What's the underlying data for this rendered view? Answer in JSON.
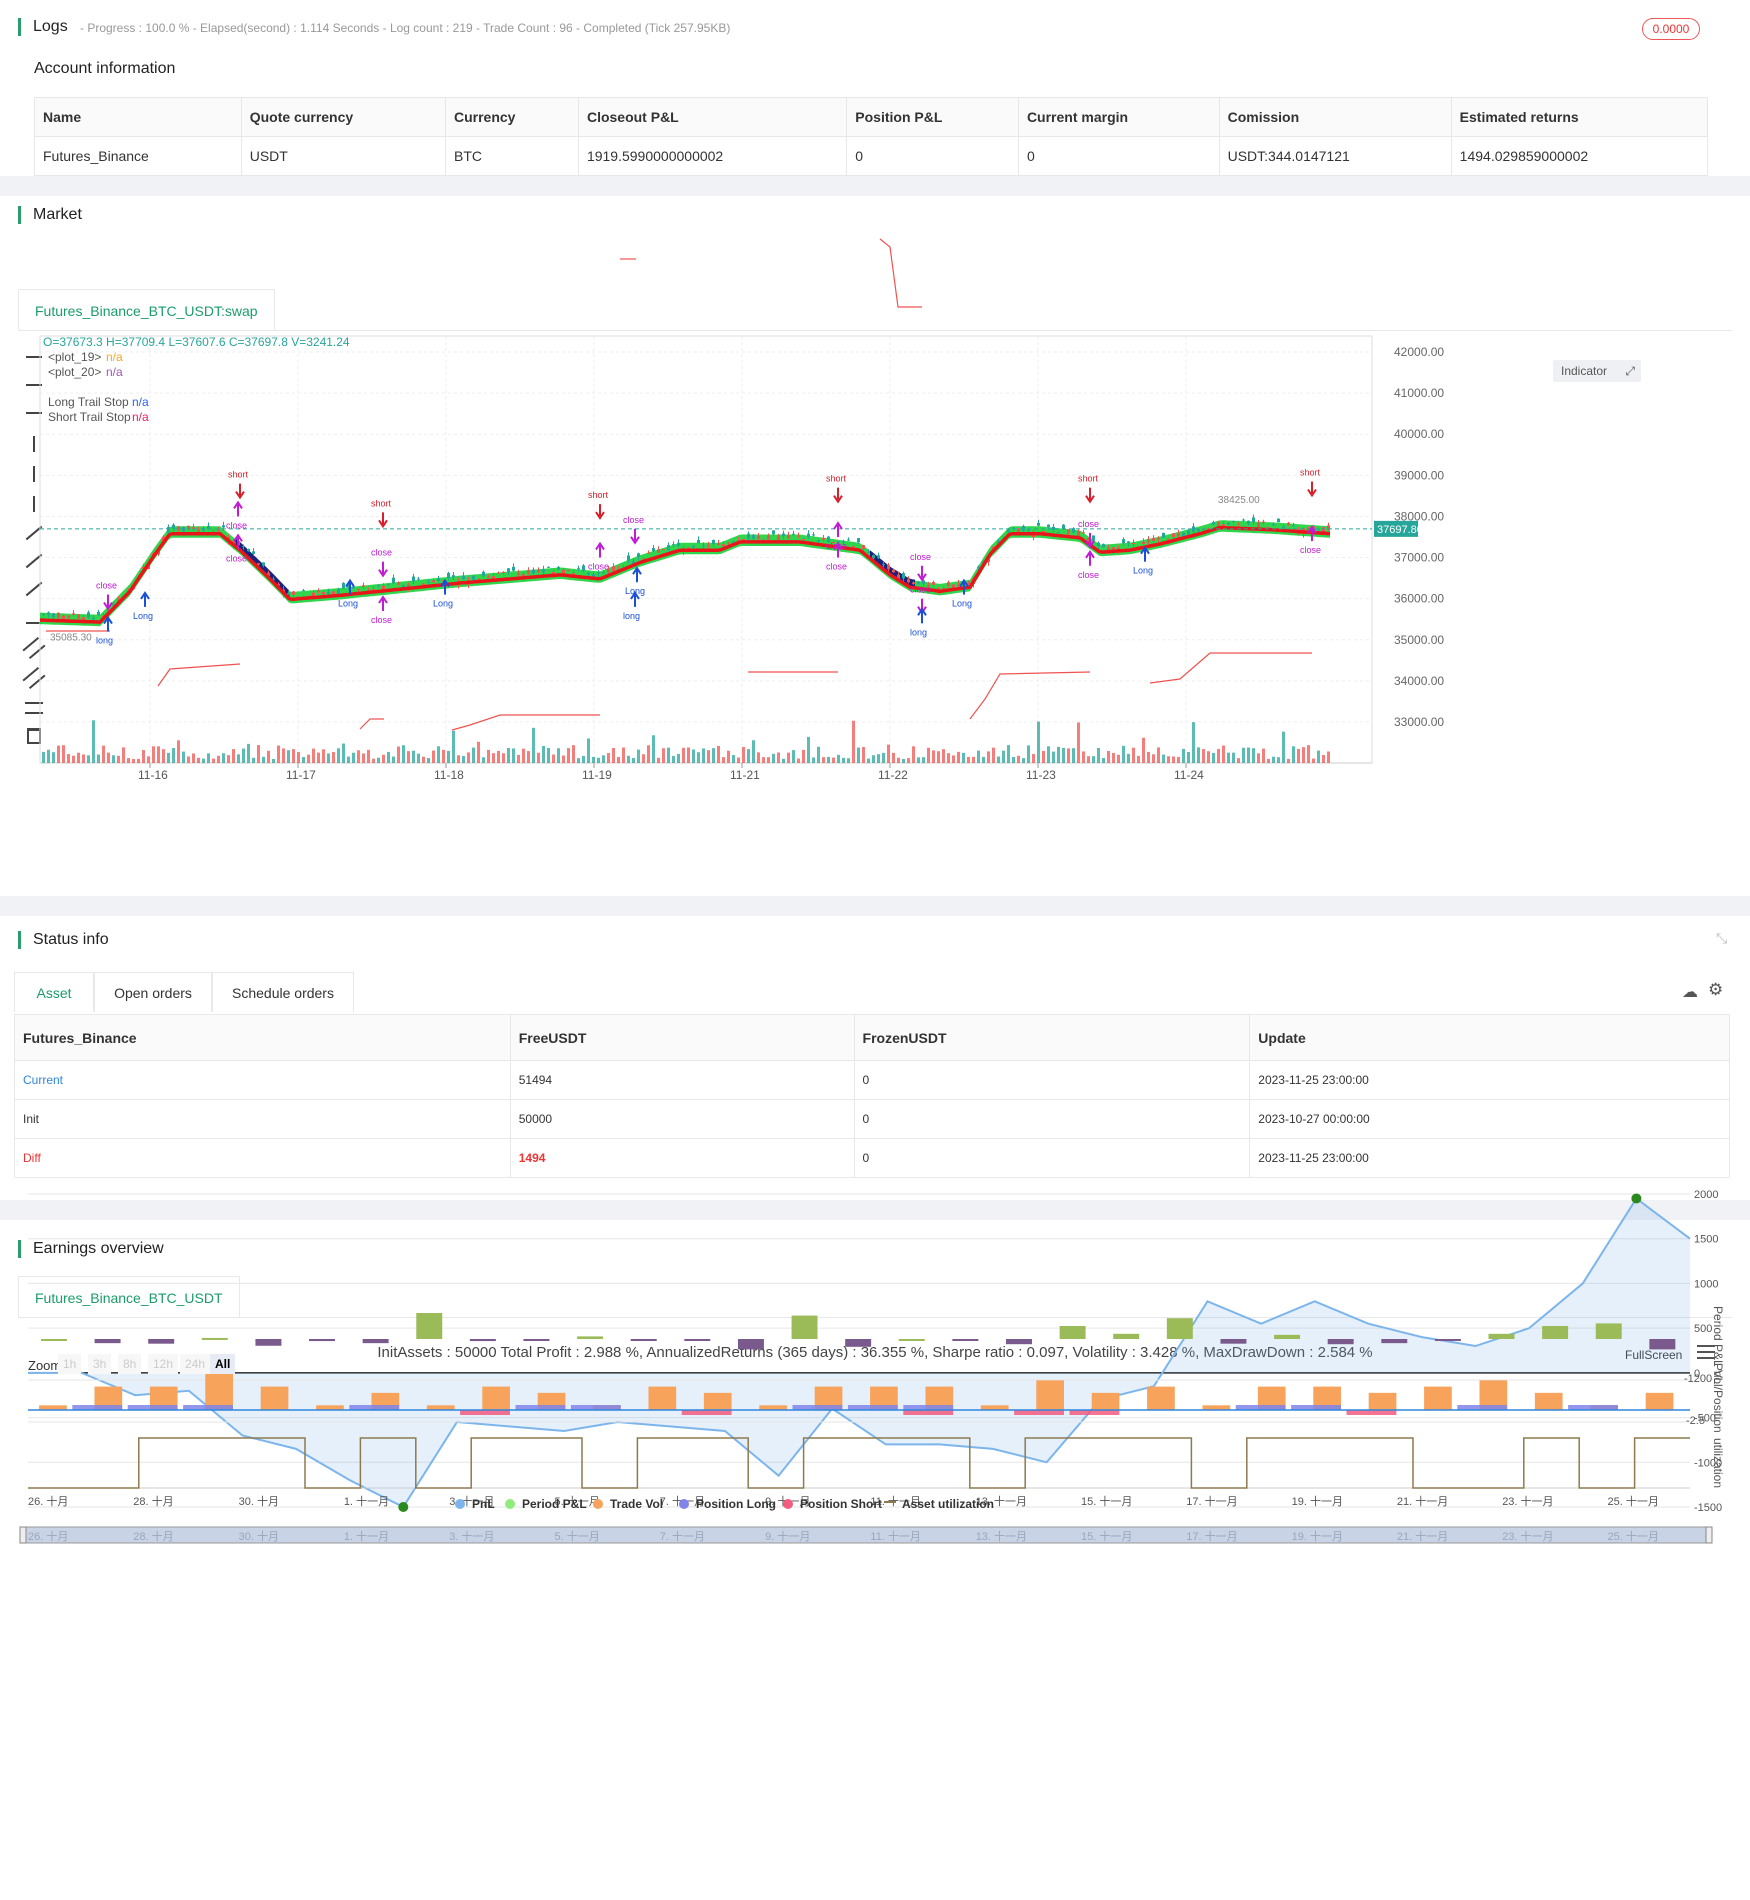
{
  "logs": {
    "title": "Logs",
    "summary": "- Progress : 100.0 % - Elapsed(second) : 1.114  Seconds - Log count : 219 - Trade Count : 96 - Completed (Tick 257.95KB)",
    "badge": "0.0000",
    "account_title": "Account information",
    "table": {
      "headers": [
        "Name",
        "Quote currency",
        "Currency",
        "Closeout P&L",
        "Position P&L",
        "Current margin",
        "Comission",
        "Estimated returns"
      ],
      "row": [
        "Futures_Binance",
        "USDT",
        "BTC",
        "1919.5990000000002",
        "0",
        "0",
        "USDT:344.0147121",
        "1494.029859000002"
      ]
    }
  },
  "market": {
    "title": "Market",
    "tab": "Futures_Binance_BTC_USDT:swap",
    "ohlc": "O=37673.3 H=37709.4 L=37607.6 C=37697.8 V=3241.24",
    "legend": [
      {
        "name": "<plot_19>",
        "value": "n/a",
        "color": "#f5a623"
      },
      {
        "name": "<plot_20>",
        "value": "n/a",
        "color": "#9b59b6"
      },
      {
        "name": "Long Trail Stop",
        "value": "n/a",
        "color": "#2962ff"
      },
      {
        "name": "Short Trail Stop",
        "value": "n/a",
        "color": "#e91e63"
      }
    ],
    "indicator_button": "Indicator",
    "price_labels": [
      "42000.00",
      "41000.00",
      "40000.00",
      "39000.00",
      "38000.00",
      "37000.00",
      "36000.00",
      "35000.00",
      "34000.00",
      "33000.00"
    ],
    "current_price": "37697.80",
    "high_marker": "38425.00",
    "low_marker": "35085.30",
    "date_labels": [
      "11-16",
      "11-17",
      "11-18",
      "11-19",
      "11-21",
      "11-22",
      "11-23",
      "11-24"
    ],
    "colors": {
      "up": "#26a69a",
      "down": "#ef5350",
      "trail": "#e8161b",
      "fill_green": "#19d33a",
      "fill_navy": "#1a237e",
      "signal_long": "#1a4fd6",
      "signal_short": "#d8202a",
      "close": "#c21bd4"
    }
  },
  "status": {
    "title": "Status info",
    "tabs": [
      "Asset",
      "Open orders",
      "Schedule orders"
    ],
    "headers": [
      "Futures_Binance",
      "FreeUSDT",
      "FrozenUSDT",
      "Update"
    ],
    "rows": [
      {
        "label": "Current",
        "free": "51494",
        "frozen": "0",
        "update": "2023-11-25 23:00:00"
      },
      {
        "label": "Init",
        "free": "50000",
        "frozen": "0",
        "update": "2023-10-27 00:00:00"
      },
      {
        "label": "Diff",
        "free": "1494",
        "frozen": "0",
        "update": "2023-11-25 23:00:00"
      }
    ]
  },
  "earnings": {
    "title": "Earnings overview",
    "tab": "Futures_Binance_BTC_USDT",
    "summary": "InitAssets : 50000 Total Profit : 2.988 %, AnnualizedReturns (365 days) : 36.355 %, Sharpe ratio : 0.097, Volatility : 3.428 %, MaxDrawDown : 2.584 %",
    "fullscreen": "FullScreen",
    "zoom_label": "Zoom",
    "zoom_options": [
      "1h",
      "3h",
      "8h",
      "12h",
      "24h",
      "All"
    ],
    "pnl_ticks": [
      "2000",
      "1500",
      "1000",
      "500",
      "0",
      "-500",
      "-1000",
      "-1500"
    ],
    "pnl_axis": "PnL",
    "period_axis": "Period P&L",
    "period_tick": "-1200",
    "vol_axis": "Vol/Position",
    "vol_tick": "-2.5",
    "util_axis": "utilization",
    "date_labels": [
      "26. 十月",
      "28. 十月",
      "30. 十月",
      "1. 十一月",
      "3. 十一月",
      "5. 十一月",
      "7. 十一月",
      "9. 十一月",
      "11. 十一月",
      "13. 十一月",
      "15. 十一月",
      "17. 十一月",
      "19. 十一月",
      "21. 十一月",
      "23. 十一月",
      "25. 十一月"
    ],
    "legend": [
      {
        "name": "PnL",
        "color": "#7cb5ec"
      },
      {
        "name": "Period P&L",
        "color": "#90ed7d"
      },
      {
        "name": "Trade Vol",
        "color": "#f7a35c"
      },
      {
        "name": "Position Long",
        "color": "#8085e9"
      },
      {
        "name": "Position Short",
        "color": "#f15c80"
      },
      {
        "name": "Asset utilization",
        "color": "#8d7b4f"
      }
    ],
    "pnl_series": [
      0,
      0,
      -250,
      -200,
      -700,
      -850,
      -1200,
      -1500,
      -550,
      -600,
      -650,
      -550,
      -600,
      -650,
      -1150,
      -400,
      -800,
      -800,
      -850,
      -1000,
      -300,
      -150,
      800,
      550,
      800,
      550,
      400,
      300,
      500,
      1000,
      1950,
      1500
    ],
    "period_pnl": [
      0,
      -80,
      -90,
      20,
      -130,
      -40,
      -80,
      500,
      -40,
      -20,
      50,
      -15,
      -15,
      -200,
      450,
      -150,
      0,
      -15,
      -100,
      250,
      100,
      400,
      -90,
      80,
      -100,
      -80,
      -20,
      100,
      250,
      300,
      -200
    ],
    "trade_vol": [
      0.3,
      1.5,
      1.5,
      2.5,
      1.5,
      0.3,
      1.1,
      0.3,
      1.5,
      1.1,
      0.3,
      1.5,
      1.1,
      0.3,
      1.5,
      1.5,
      1.5,
      0.3,
      1.9,
      1.1,
      1.5,
      0.3,
      1.5,
      1.5,
      1.1,
      1.5,
      1.9,
      1.1,
      0.3,
      1.1
    ],
    "position_long": [
      0,
      0.3,
      0.3,
      0.3,
      0,
      0,
      0.3,
      0,
      0,
      0.3,
      0.3,
      0,
      0,
      0,
      0.3,
      0.3,
      0.3,
      0,
      0,
      0,
      0,
      0,
      0.3,
      0.3,
      0,
      0,
      0.3,
      0,
      0.3,
      0
    ],
    "position_short": [
      0,
      0,
      0,
      0,
      0,
      0,
      0,
      0,
      -0.3,
      0,
      0,
      0,
      -0.3,
      0,
      0,
      0,
      -0.3,
      0,
      -0.3,
      -0.3,
      0,
      0,
      0,
      0,
      -0.3,
      0,
      0,
      0,
      0,
      0
    ],
    "utilization": [
      0,
      0,
      1,
      1,
      1,
      0,
      1,
      0,
      1,
      1,
      0,
      1,
      1,
      0,
      1,
      1,
      1,
      0,
      1,
      1,
      1,
      0,
      1,
      1,
      1,
      0,
      0,
      1,
      0,
      1
    ]
  }
}
